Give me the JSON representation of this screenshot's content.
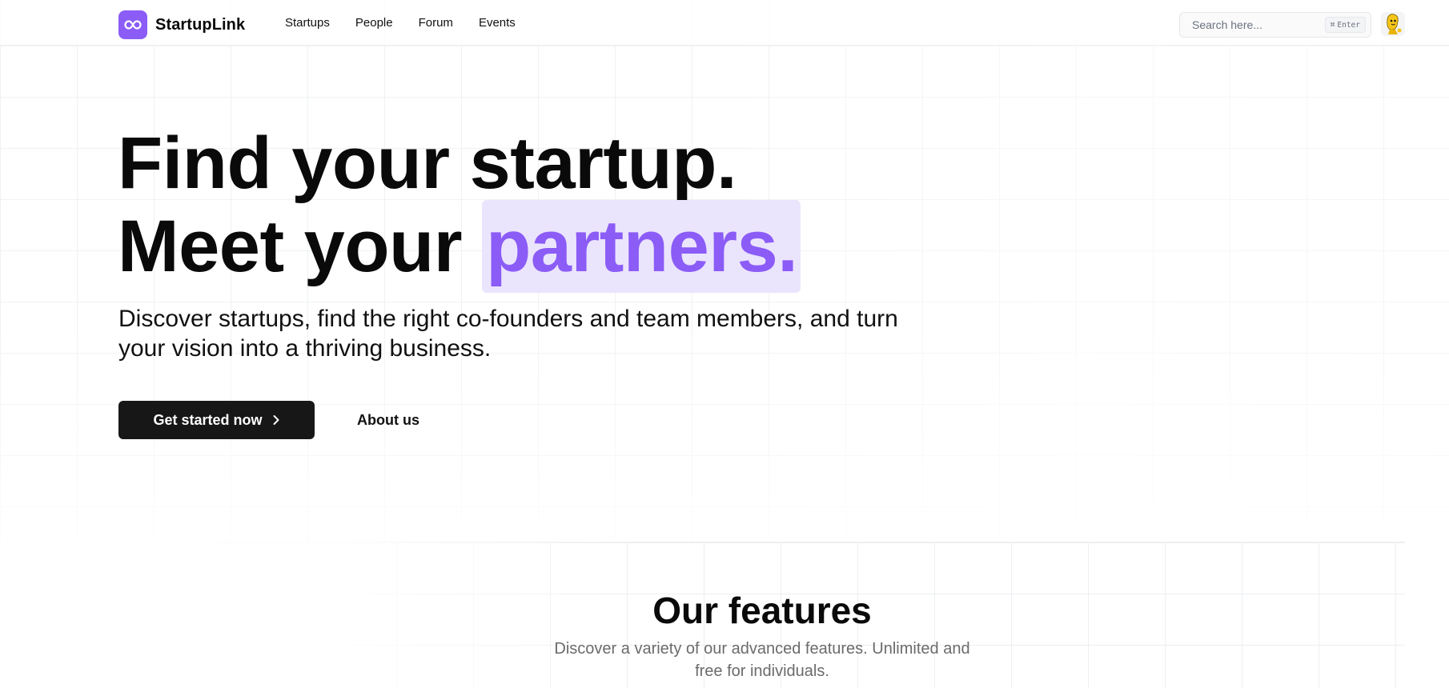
{
  "header": {
    "brand": "StartupLink",
    "nav": [
      "Startups",
      "People",
      "Forum",
      "Events"
    ],
    "search": {
      "placeholder": "Search here...",
      "shortcut_symbol": "⌘",
      "shortcut_key": "Enter"
    }
  },
  "hero": {
    "line1": "Find your startup.",
    "line2_prefix": "Meet your ",
    "line2_highlight": "partners.",
    "subtitle": "Discover startups, find the right co-founders and team members, and turn your vision into a thriving business.",
    "cta_primary": "Get started now",
    "cta_secondary": "About us"
  },
  "features": {
    "title": "Our features",
    "subtitle": "Discover a variety of our advanced features. Unlimited and free for individuals."
  },
  "colors": {
    "accent": "#8b5cf6",
    "highlight_bg": "#ebe4fd",
    "primary_button": "#171717",
    "text": "#0a0a0a",
    "muted": "#6b6b6b"
  },
  "icons": {
    "logo": "infinity-icon",
    "cta": "chevron-right-icon",
    "avatar": "cartoon-avatar"
  }
}
